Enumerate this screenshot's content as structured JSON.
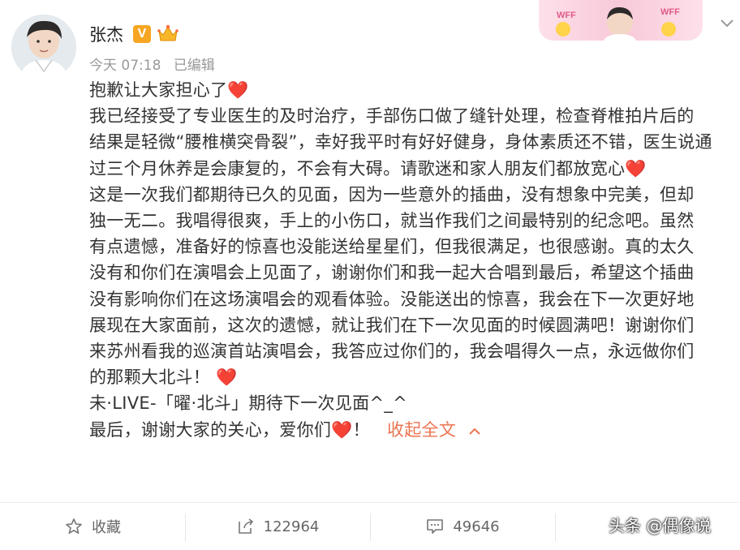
{
  "post": {
    "author": "张杰",
    "verified_badge": "V",
    "time": "今天 07:18",
    "edited": "已编辑",
    "banner_text": "WFF",
    "lines": [
      "抱歉让大家担心了",
      "我已经接受了专业医生的及时治疗，手部伤口做了缝针处理，检查脊椎拍片后的",
      "结果是轻微“腰椎横突骨裂”，幸好我平时有好好健身，身体素质还不错，医生说通",
      "过三个月休养是会康复的，不会有大碍。请歌迷和家人朋友们都放宽心",
      "这是一次我们都期待已久的见面，因为一些意外的插曲，没有想象中完美，但却",
      "独一无二。我唱得很爽，手上的小伤口，就当作我们之间最特别的纪念吧。虽然",
      "有点遗憾，准备好的惊喜也没能送给星星们，但我很满足，也很感谢。真的太久",
      "没有和你们在演唱会上见面了，谢谢你们和我一起大合唱到最后，希望这个插曲",
      "没有影响你们在这场演唱会的观看体验。没能送出的惊喜，我会在下一次更好地",
      "展现在大家面前，这次的遗憾，就让我们在下一次见面的时候圆满吧！谢谢你们",
      "来苏州看我的巡演首站演唱会，我答应过你们的，我会唱得久一点，永远做你们",
      "的那颗大北斗！",
      "未·LIVE-「曜·北斗」期待下一次见面^_^",
      "最后，谢谢大家的关心，爱你们"
    ],
    "last_line_suffix": "！",
    "heart_emoji": "❤️",
    "fold_label": "收起全文"
  },
  "actions": {
    "favorite_label": "收藏",
    "repost_count": "122964",
    "comment_count": "49646"
  },
  "watermark": "头条 @偶像说",
  "colors": {
    "heart": "#e8452d",
    "link": "#eb7350",
    "badge": "#f6a623"
  }
}
